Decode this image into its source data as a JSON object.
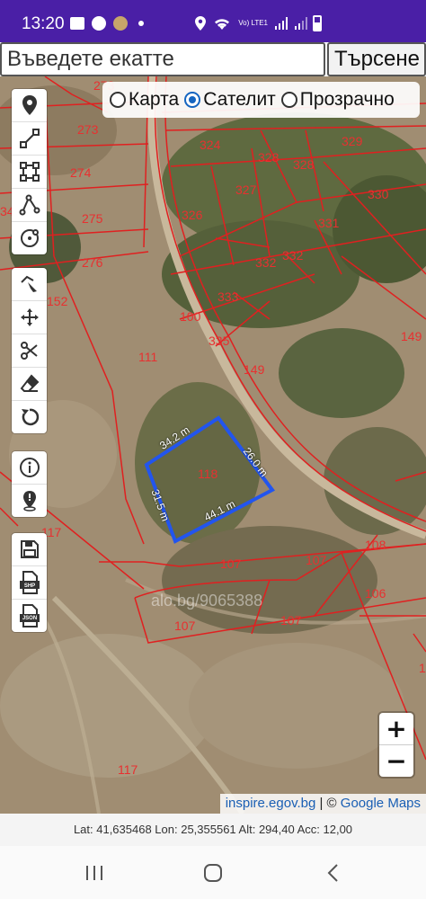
{
  "status_bar": {
    "time": "13:20",
    "network": "Vo) LTE1"
  },
  "search": {
    "placeholder": "Въведете екатте",
    "value": "",
    "button_label": "Търсене"
  },
  "layers": {
    "options": [
      {
        "label": "Карта",
        "selected": false
      },
      {
        "label": "Сателит",
        "selected": true
      },
      {
        "label": "Прозрачно",
        "selected": false
      }
    ]
  },
  "tools": {
    "group1": [
      "marker-icon",
      "line-icon",
      "polygon-icon",
      "polyline-icon",
      "circle-icon"
    ],
    "group2": [
      "select-edit-icon",
      "move-icon",
      "cut-icon",
      "eraser-icon",
      "undo-icon"
    ],
    "group3": [
      "info-icon",
      "location-icon"
    ],
    "group4": [
      "save-icon",
      "shp-export-icon",
      "json-export-icon"
    ],
    "shp_label": "SHP",
    "json_label": "JSON"
  },
  "parcels": {
    "labels": [
      "273",
      "273",
      "274",
      "275",
      "276",
      "152",
      "34",
      "324",
      "328",
      "329",
      "328",
      "327",
      "330",
      "326",
      "331",
      "332",
      "332",
      "333",
      "100",
      "335",
      "149",
      "149",
      "111",
      "118",
      "117",
      "107",
      "107",
      "107",
      "106",
      "108",
      "107",
      "117",
      "1"
    ]
  },
  "measurement": {
    "edges": [
      "34.2 m",
      "26.0 m",
      "44.1 m",
      "31.5 m"
    ],
    "watermark": "alo.bg/9065388"
  },
  "zoom": {
    "in_label": "+",
    "out_label": "−"
  },
  "attribution": {
    "source": "inspire.egov.bg",
    "separator": " | © ",
    "maps": "Google Maps"
  },
  "gps": {
    "text": "Lat: 41,635468 Lon: 25,355561 Alt: 294,40 Acc: 12,00"
  },
  "colors": {
    "status_bar": "#4a1fa6",
    "parcel_line": "#e02020",
    "measure_line": "#2255ee",
    "accent": "#1565c0"
  }
}
